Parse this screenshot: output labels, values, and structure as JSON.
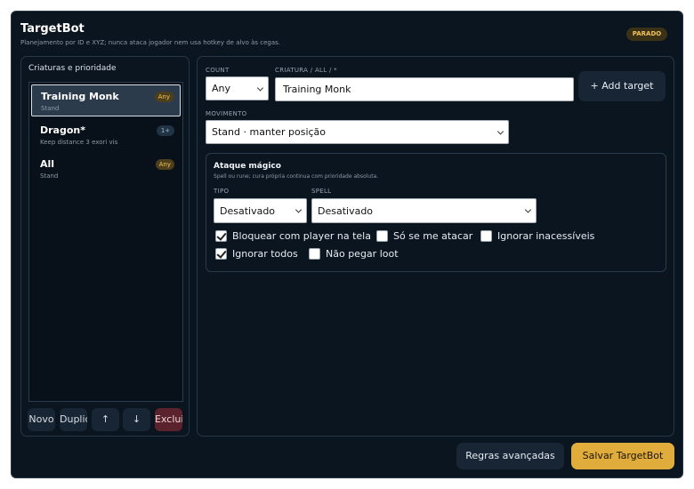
{
  "header": {
    "title": "TargetBot",
    "subtitle": "Planejamento por ID e XYZ; nunca ataca jogador nem usa hotkey de alvo às cegas.",
    "status": "PARADO",
    "status_color": "#f3c25a"
  },
  "creatures": {
    "title": "Criaturas e prioridade",
    "items": [
      {
        "name": "Training Monk",
        "sub": "Stand",
        "badge": "Any",
        "selected": true
      },
      {
        "name": "Dragon*",
        "sub": "Keep distance 3  exori vis",
        "badge": "1+",
        "selected": false
      },
      {
        "name": "All",
        "sub": "Stand",
        "badge": "Any",
        "selected": false
      }
    ],
    "buttons": {
      "new": "Novo",
      "duplicate": "Duplicar",
      "up": "↑",
      "down": "↓",
      "delete": "Excluir"
    }
  },
  "form": {
    "count_label": "COUNT",
    "count_value": "Any",
    "creature_label": "CRIATURA / ALL / *",
    "creature_value": "Training Monk",
    "add_target": "+ Add target",
    "movement_label": "MOVIMENTO",
    "movement_value": "Stand · manter posição"
  },
  "magic": {
    "title": "Ataque mágico",
    "subtitle": "Spell ou rune; cura própria continua com prioridade absoluta.",
    "type_label": "TIPO",
    "type_value": "Desativado",
    "spell_label": "SPELL",
    "spell_value": "Desativado",
    "options": [
      {
        "label": "Bloquear com player na tela",
        "checked": true
      },
      {
        "label": "Só se me atacar",
        "checked": false
      },
      {
        "label": "Ignorar inacessíveis",
        "checked": false
      },
      {
        "label": "Ignorar todos",
        "checked": true
      },
      {
        "label": "Não pegar loot",
        "checked": false
      }
    ]
  },
  "footer": {
    "advanced": "Regras avançadas",
    "save": "Salvar TargetBot",
    "accent_color": "#e0ac3c"
  }
}
